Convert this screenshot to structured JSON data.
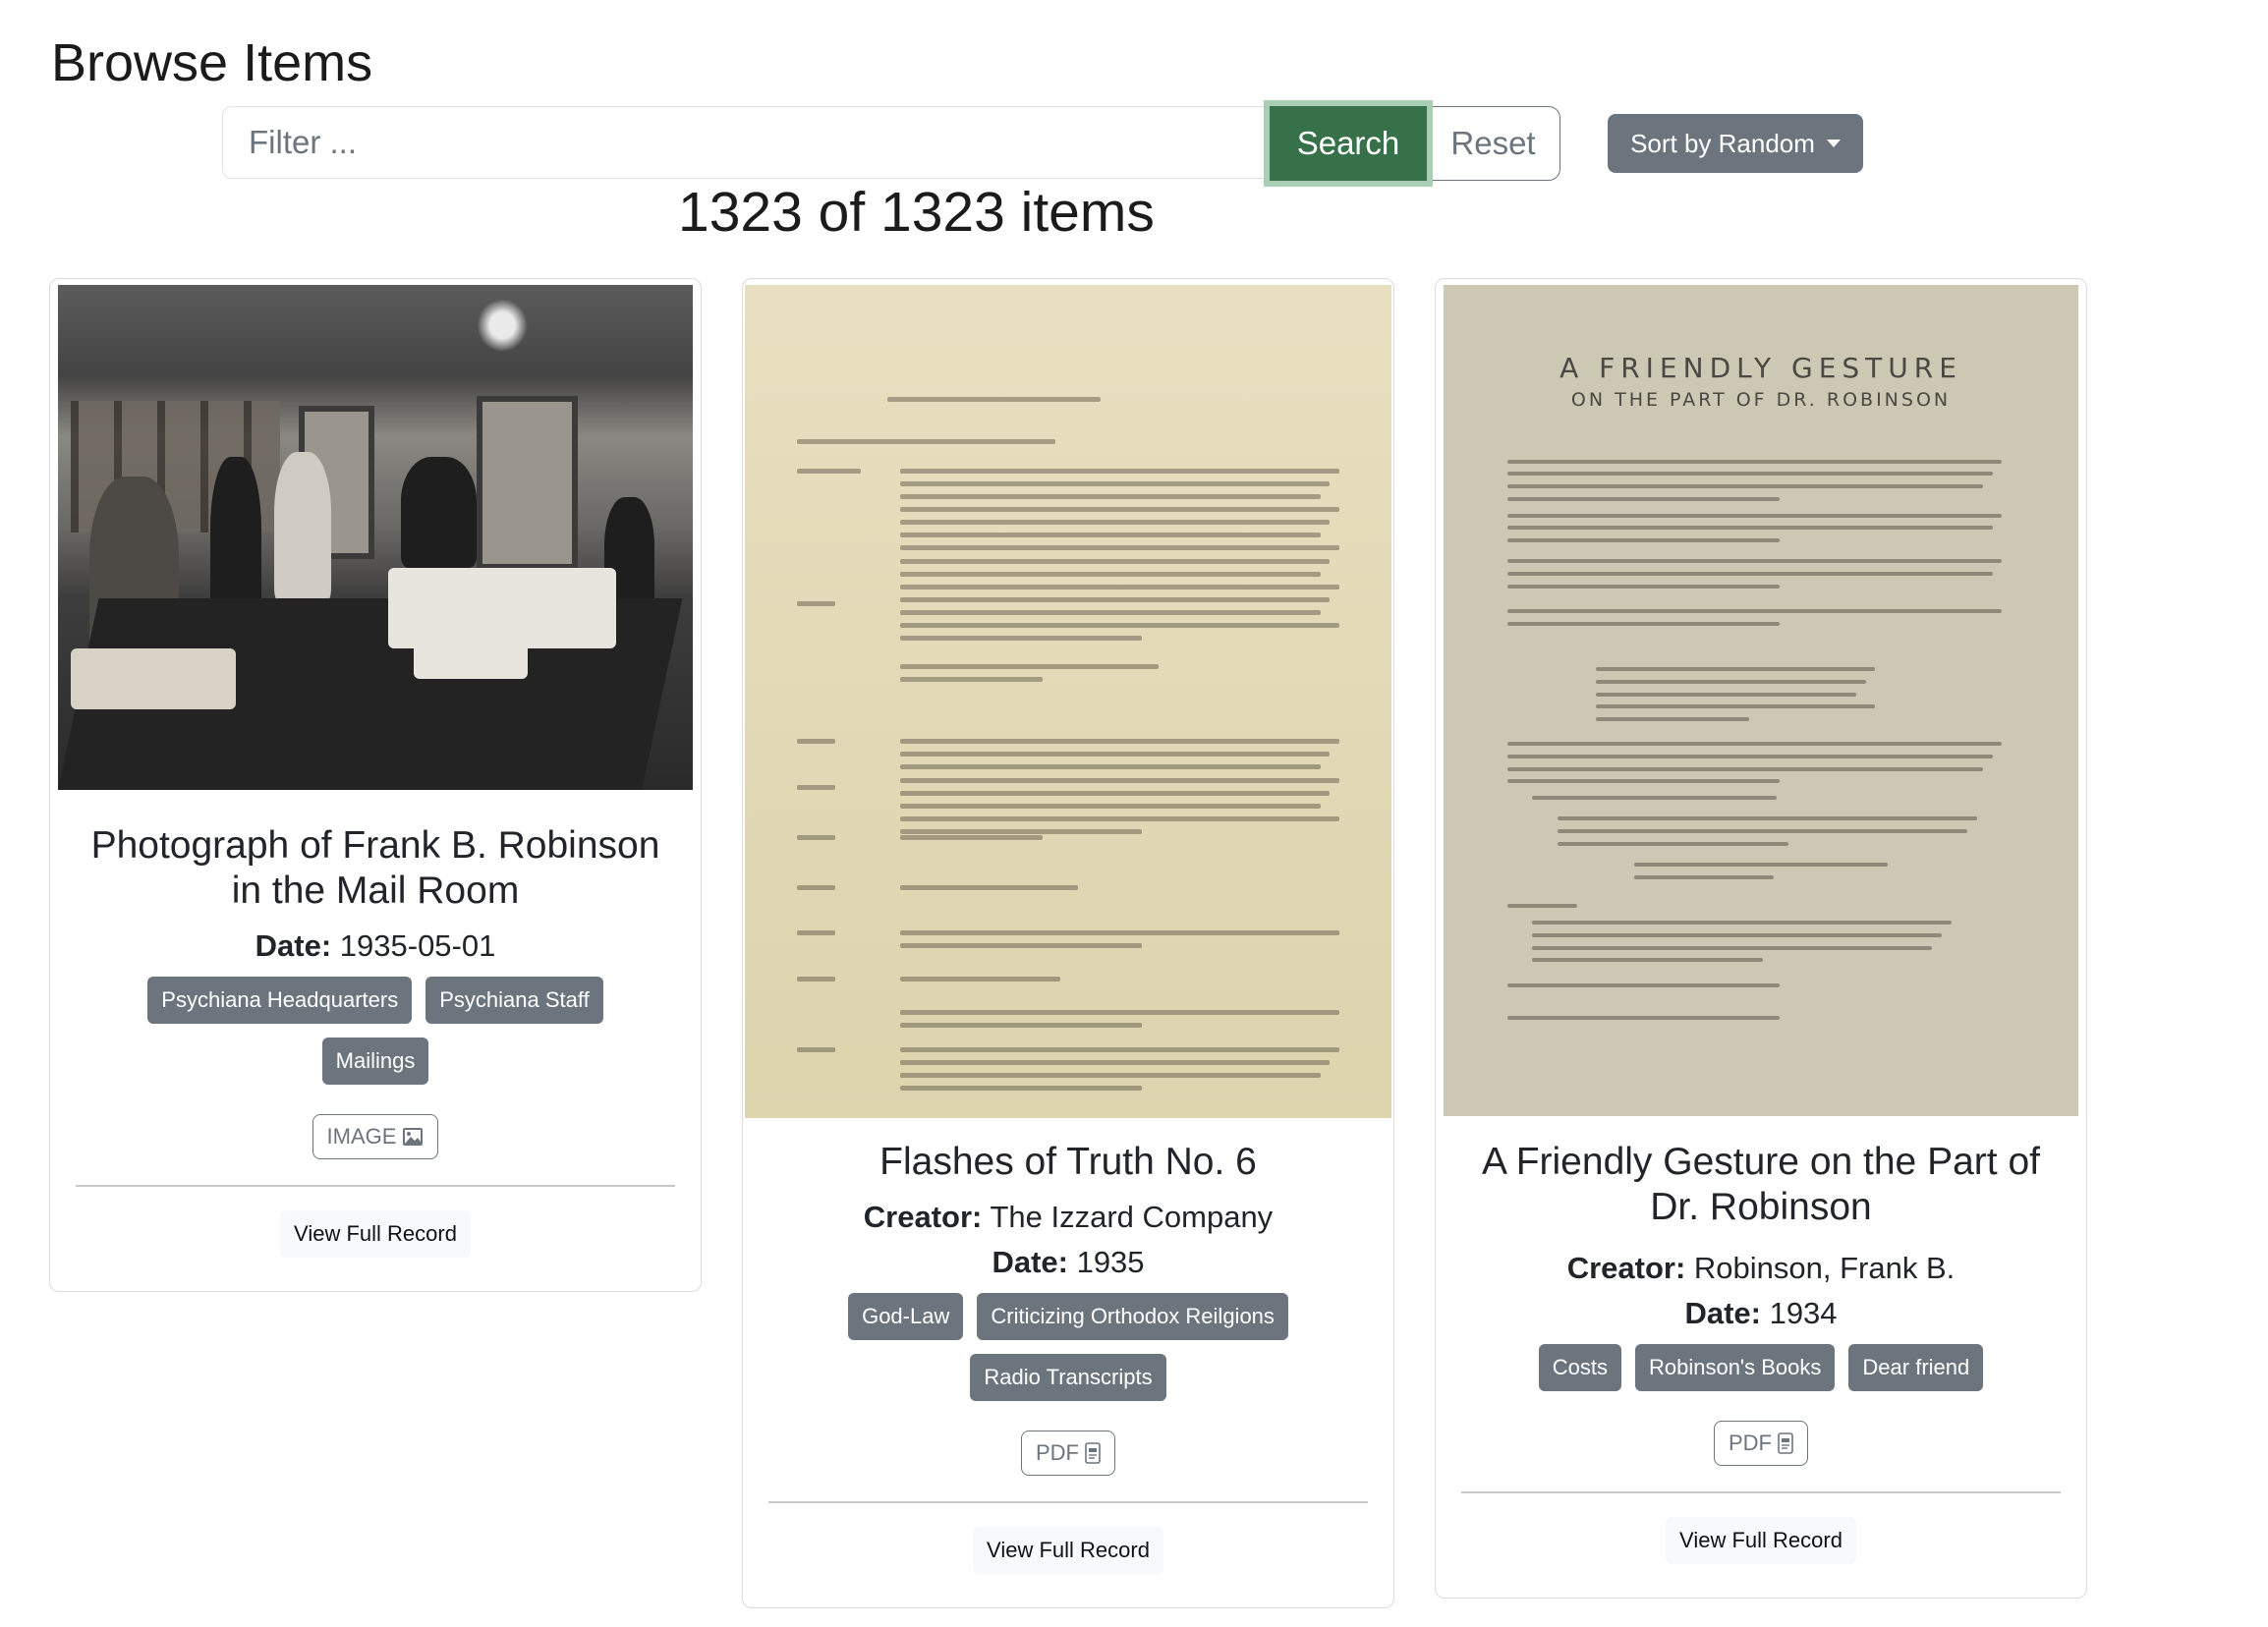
{
  "page": {
    "title": "Browse Items"
  },
  "search": {
    "placeholder": "Filter ...",
    "value": "",
    "search_label": "Search",
    "reset_label": "Reset",
    "sort_label": "Sort by Random"
  },
  "results": {
    "count_text": "1323 of 1323 items",
    "shown": 1323,
    "total": 1323
  },
  "colors": {
    "search_button": "#367149",
    "tag": "#6c757d",
    "sort_button": "#6c757d"
  },
  "items": [
    {
      "title": "Photograph of Frank B. Robinson in the Mail Room",
      "date_label": "Date:",
      "date": "1935-05-01",
      "tags": [
        "Psychiana Headquarters",
        "Psychiana Staff",
        "Mailings"
      ],
      "type_label": "IMAGE",
      "type_icon": "image-icon",
      "view_label": "View Full Record"
    },
    {
      "title": "Flashes of Truth No. 6",
      "creator_label": "Creator:",
      "creator": "The Izzard Company",
      "date_label": "Date:",
      "date": "1935",
      "tags": [
        "God-Law",
        "Criticizing Orthodox Reilgions",
        "Radio Transcripts"
      ],
      "type_label": "PDF",
      "type_icon": "pdf-file-icon",
      "view_label": "View Full Record"
    },
    {
      "title": "A Friendly Gesture on the Part of Dr. Robinson",
      "creator_label": "Creator:",
      "creator": "Robinson, Frank B.",
      "date_label": "Date:",
      "date": "1934",
      "tags": [
        "Costs",
        "Robinson's Books",
        "Dear friend"
      ],
      "type_label": "PDF",
      "type_icon": "pdf-file-icon",
      "view_label": "View Full Record",
      "thumb_heading": "A FRIENDLY GESTURE",
      "thumb_subheading": "ON THE PART OF DR. ROBINSON"
    }
  ]
}
